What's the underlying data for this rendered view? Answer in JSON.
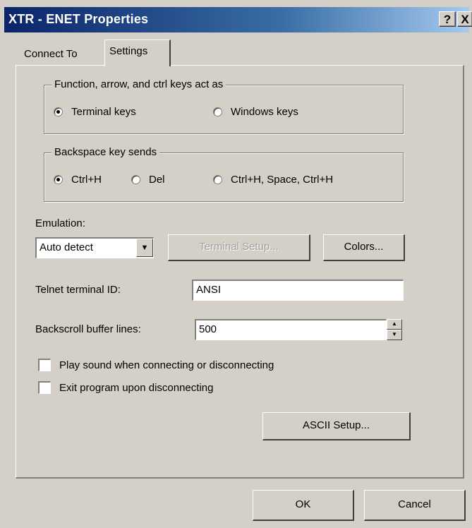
{
  "window": {
    "title": "XTR - ENET Properties",
    "help_label": "?",
    "close_label": "X"
  },
  "tabs": [
    {
      "label": "Connect To",
      "selected": false
    },
    {
      "label": "Settings",
      "selected": true
    }
  ],
  "function_keys_group": {
    "legend": "Function, arrow, and ctrl keys act as",
    "options": [
      {
        "label": "Terminal keys",
        "checked": true
      },
      {
        "label": "Windows keys",
        "checked": false
      }
    ]
  },
  "backspace_group": {
    "legend": "Backspace key sends",
    "options": [
      {
        "label": "Ctrl+H",
        "checked": true
      },
      {
        "label": "Del",
        "checked": false
      },
      {
        "label": "Ctrl+H, Space, Ctrl+H",
        "checked": false
      }
    ]
  },
  "emulation": {
    "label": "Emulation:",
    "value": "Auto detect",
    "terminal_setup_label": "Terminal Setup...",
    "colors_label": "Colors..."
  },
  "telnet": {
    "label": "Telnet terminal ID:",
    "value": "ANSI"
  },
  "backscroll": {
    "label": "Backscroll buffer lines:",
    "value": "500"
  },
  "checkboxes": [
    {
      "label": "Play sound when connecting or disconnecting",
      "checked": false
    },
    {
      "label": "Exit program upon disconnecting",
      "checked": false
    }
  ],
  "ascii_setup_label": "ASCII Setup...",
  "footer": {
    "ok_label": "OK",
    "cancel_label": "Cancel"
  }
}
